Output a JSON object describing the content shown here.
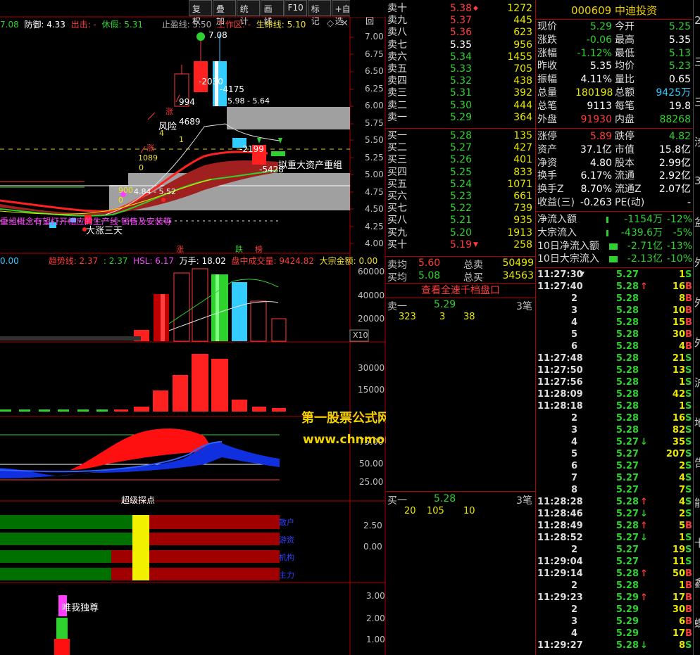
{
  "toolbar": [
    "复权",
    "叠加",
    "统计",
    "画线",
    "F10",
    "标记",
    "+自选",
    "返回"
  ],
  "main_indicator": {
    "a": "7.08",
    "b": "防御: 4.33",
    "c": "出击: -",
    "d": "休假: 5.31",
    "e": "止盈线: 5.50",
    "f": "工作区: -",
    "g": "生命线: 5.10"
  },
  "price_axis": [
    "7.00",
    "6.75",
    "6.50",
    "6.25",
    "6.00",
    "5.75",
    "5.50",
    "5.25",
    "5.00",
    "4.75",
    "4.50",
    "4.25",
    "4.00"
  ],
  "chart_labels": {
    "hi": "7.08",
    "l2030": "-2030",
    "l4175": "-4175",
    "l994": "994",
    "l4689": "4689",
    "fx": "风险",
    "f4": "4",
    "f1": "1",
    "zz": "5.98 - 5.64",
    "l2199": "-2199",
    "l5428": "-5428",
    "news": "拟重大资产重组",
    "zhang1": "涨",
    "zhang2": "涨",
    "z1089": "1089",
    "z0": "0",
    "l484": "4.84 - 5.52",
    "l900": "900",
    "z0b": "0",
    "dzst": "大涨三天",
    "bottom_text": "重组概念有望打开相应的生产线 销售及安装等",
    "t1": "涨",
    "t2": "跌",
    "t3": "榜",
    "x10": "X10",
    "cjzd": "超级探点",
    "wwdz": "唯我独尊"
  },
  "vol_header": {
    "a": "0.00",
    "b": "趋势线: 2.37",
    "c": ": 2.37",
    "d": "HSL: 6.17",
    "e": "万手: 18.02",
    "f": "盘中成交量: 9424.82",
    "g": "大宗金额: 0.00"
  },
  "vol_axis": [
    "60000",
    "40000",
    "20000"
  ],
  "p3_axis": [
    "30000",
    "15000"
  ],
  "p4_axis": [
    "75.00",
    "50.00",
    "25.00"
  ],
  "p5_axis": [
    "2.50",
    "0.00"
  ],
  "p5_labels": [
    "散户",
    "游资",
    "机构",
    "主力"
  ],
  "p6_axis": [
    "3.00",
    "2.00",
    "1.00"
  ],
  "watermark": {
    "line1": "第一股票公式网",
    "line2": "www.chnmoney.com"
  },
  "sells": [
    {
      "name": "卖十",
      "price": "5.38",
      "flag": "◆",
      "vol": "1272",
      "color": "#ff3c3c"
    },
    {
      "name": "卖九",
      "price": "5.37",
      "vol": "445",
      "color": "#ff3c3c"
    },
    {
      "name": "卖八",
      "price": "5.36",
      "vol": "623",
      "color": "#ff3c3c"
    },
    {
      "name": "卖七",
      "price": "5.35",
      "vol": "956",
      "color": "#ffffff"
    },
    {
      "name": "卖六",
      "price": "5.34",
      "vol": "1455",
      "color": "#2fd12f"
    },
    {
      "name": "卖五",
      "price": "5.33",
      "vol": "705",
      "color": "#2fd12f"
    },
    {
      "name": "卖四",
      "price": "5.32",
      "vol": "438",
      "color": "#2fd12f"
    },
    {
      "name": "卖三",
      "price": "5.31",
      "vol": "392",
      "color": "#2fd12f"
    },
    {
      "name": "卖二",
      "price": "5.30",
      "vol": "444",
      "color": "#2fd12f"
    },
    {
      "name": "卖一",
      "price": "5.29",
      "vol": "364",
      "color": "#2fd12f"
    }
  ],
  "buys": [
    {
      "name": "买一",
      "price": "5.28",
      "vol": "135",
      "color": "#2fd12f"
    },
    {
      "name": "买二",
      "price": "5.27",
      "vol": "427",
      "color": "#2fd12f"
    },
    {
      "name": "买三",
      "price": "5.26",
      "vol": "401",
      "color": "#2fd12f"
    },
    {
      "name": "买四",
      "price": "5.25",
      "vol": "833",
      "color": "#2fd12f"
    },
    {
      "name": "买五",
      "price": "5.24",
      "vol": "1071",
      "color": "#2fd12f"
    },
    {
      "name": "买六",
      "price": "5.23",
      "vol": "661",
      "color": "#2fd12f"
    },
    {
      "name": "买七",
      "price": "5.22",
      "vol": "739",
      "color": "#2fd12f"
    },
    {
      "name": "买八",
      "price": "5.21",
      "vol": "935",
      "color": "#2fd12f"
    },
    {
      "name": "买九",
      "price": "5.20",
      "vol": "1913",
      "color": "#2fd12f"
    },
    {
      "name": "买十",
      "price": "5.19",
      "flag": "▼",
      "vol": "258",
      "color": "#ff3c3c"
    }
  ],
  "avg": {
    "sell_label": "卖均",
    "sell_price": "5.60",
    "sell_total_label": "总卖",
    "sell_total": "50499",
    "buy_label": "买均",
    "buy_price": "5.08",
    "buy_total_label": "总买",
    "buy_total": "34563"
  },
  "full_depth_button": "查看全速千档盘口",
  "sell1_detail": {
    "label": "卖一",
    "price": "5.29",
    "count": "3笔",
    "orders": [
      "323",
      "3",
      "38"
    ]
  },
  "buy1_detail": {
    "label": "买一",
    "price": "5.28",
    "count": "3笔",
    "orders": [
      "20",
      "105",
      "10"
    ]
  },
  "stock": {
    "code": "000609",
    "name": "中迪投资"
  },
  "quote_rows": [
    {
      "l1": "现价",
      "v1": "5.29",
      "c1": "#2fd12f",
      "l2": "今开",
      "v2": "5.25",
      "c2": "#2fd12f"
    },
    {
      "l1": "涨跌",
      "v1": "-0.06",
      "c1": "#2fd12f",
      "l2": "最高",
      "v2": "5.35",
      "c2": "#ffffff"
    },
    {
      "l1": "涨幅",
      "v1": "-1.12%",
      "c1": "#2fd12f",
      "l2": "最低",
      "v2": "5.13",
      "c2": "#2fd12f"
    },
    {
      "l1": "昨收",
      "v1": "5.35",
      "c1": "#ffffff",
      "l2": "均价",
      "v2": "5.23",
      "c2": "#2fd12f"
    },
    {
      "l1": "振幅",
      "v1": "4.11%",
      "c1": "#ffffff",
      "l2": "量比",
      "v2": "0.65",
      "c2": "#ffffff"
    },
    {
      "l1": "总量",
      "v1": "180198",
      "c1": "#e8e800",
      "l2": "总额",
      "v2": "9425万",
      "c2": "#3cf"
    },
    {
      "l1": "总笔",
      "v1": "9113",
      "c1": "#ffffff",
      "l2": "每笔",
      "v2": "19.8",
      "c2": "#ffffff"
    },
    {
      "l1": "外盘",
      "v1": "91930",
      "c1": "#ff3c3c",
      "l2": "内盘",
      "v2": "88268",
      "c2": "#2fd12f"
    }
  ],
  "quote_rows2": [
    {
      "l1": "涨停",
      "v1": "5.89",
      "c1": "#ff3c3c",
      "l2": "跌停",
      "v2": "4.82",
      "c2": "#2fd12f"
    },
    {
      "l1": "资产",
      "v1": "37.1亿",
      "c1": "#ffffff",
      "l2": "市值",
      "v2": "15.8亿",
      "c2": "#ffffff"
    },
    {
      "l1": "净资",
      "v1": "4.80",
      "c1": "#ffffff",
      "l2": "股本",
      "v2": "2.99亿",
      "c2": "#ffffff"
    },
    {
      "l1": "换手",
      "v1": "6.17%",
      "c1": "#ffffff",
      "l2": "流通",
      "v2": "2.92亿",
      "c2": "#ffffff"
    },
    {
      "l1": "换手Z",
      "v1": "8.70%",
      "c1": "#ffffff",
      "l2": "流通Z",
      "v2": "2.07亿",
      "c2": "#ffffff"
    },
    {
      "l1": "收益(三)",
      "v1": "-0.263",
      "c1": "#ffffff",
      "l2": "PE(动)",
      "v2": "-",
      "c2": "#ffffff"
    }
  ],
  "flows": [
    {
      "label": "净流入额",
      "value": "-1154万",
      "pct": "-12%"
    },
    {
      "label": "大宗流入",
      "value": "-439.6万",
      "pct": "-5%"
    },
    {
      "label": "10日净流入额",
      "value": "-2.71亿",
      "pct": "-13%"
    },
    {
      "label": "10日大宗流入",
      "value": "-2.13亿",
      "pct": "-10%"
    }
  ],
  "ticks": [
    {
      "t": "11:27:30",
      "mark": "▼",
      "p": "5.27",
      "pc": "#2fd12f",
      "a": "",
      "v": "1",
      "s": "S"
    },
    {
      "t": "11:27:40",
      "p": "5.28",
      "pc": "#2fd12f",
      "a": "↑",
      "ac": "#ff3c3c",
      "v": "16",
      "s": "B"
    },
    {
      "t": "2",
      "p": "5.28",
      "pc": "#2fd12f",
      "a": "",
      "v": "8",
      "s": "B"
    },
    {
      "t": "3",
      "p": "5.28",
      "pc": "#2fd12f",
      "a": "",
      "v": "10",
      "s": "B"
    },
    {
      "t": "4",
      "p": "5.28",
      "pc": "#2fd12f",
      "a": "",
      "v": "15",
      "s": "B"
    },
    {
      "t": "5",
      "p": "5.28",
      "pc": "#2fd12f",
      "a": "",
      "v": "30",
      "s": "B"
    },
    {
      "t": "6",
      "p": "5.28",
      "pc": "#2fd12f",
      "a": "",
      "v": "4",
      "s": "B"
    },
    {
      "t": "11:27:48",
      "p": "5.28",
      "pc": "#2fd12f",
      "a": "",
      "v": "21",
      "s": "S"
    },
    {
      "t": "11:27:50",
      "p": "5.28",
      "pc": "#2fd12f",
      "a": "",
      "v": "13",
      "s": "S"
    },
    {
      "t": "11:27:56",
      "p": "5.28",
      "pc": "#2fd12f",
      "a": "",
      "v": "1",
      "s": "S"
    },
    {
      "t": "11:28:09",
      "p": "5.28",
      "pc": "#2fd12f",
      "a": "",
      "v": "42",
      "s": "S"
    },
    {
      "t": "11:28:18",
      "p": "5.28",
      "pc": "#2fd12f",
      "a": "",
      "v": "1",
      "s": "S"
    },
    {
      "t": "2",
      "p": "5.28",
      "pc": "#2fd12f",
      "a": "",
      "v": "16",
      "s": "S"
    },
    {
      "t": "3",
      "p": "5.28",
      "pc": "#2fd12f",
      "a": "",
      "v": "82",
      "s": "S"
    },
    {
      "t": "4",
      "p": "5.27",
      "pc": "#2fd12f",
      "a": "↓",
      "ac": "#2fd12f",
      "v": "35",
      "s": "S"
    },
    {
      "t": "5",
      "p": "5.27",
      "pc": "#2fd12f",
      "a": "",
      "v": "207",
      "s": "S"
    },
    {
      "t": "6",
      "p": "5.27",
      "pc": "#2fd12f",
      "a": "",
      "v": "2",
      "s": "S"
    },
    {
      "t": "7",
      "p": "5.27",
      "pc": "#2fd12f",
      "a": "",
      "v": "4",
      "s": "S"
    },
    {
      "t": "8",
      "p": "5.27",
      "pc": "#2fd12f",
      "a": "",
      "v": "7",
      "s": "S"
    },
    {
      "t": "11:28:28",
      "p": "5.28",
      "pc": "#2fd12f",
      "a": "↑",
      "ac": "#ff3c3c",
      "v": "4",
      "s": "S"
    },
    {
      "t": "11:28:46",
      "p": "5.27",
      "pc": "#2fd12f",
      "a": "↓",
      "ac": "#2fd12f",
      "v": "2",
      "s": "S"
    },
    {
      "t": "11:28:49",
      "p": "5.28",
      "pc": "#2fd12f",
      "a": "↑",
      "ac": "#ff3c3c",
      "v": "5",
      "s": "B"
    },
    {
      "t": "11:28:52",
      "p": "5.27",
      "pc": "#2fd12f",
      "a": "↓",
      "ac": "#2fd12f",
      "v": "1",
      "s": "S"
    },
    {
      "t": "2",
      "p": "5.27",
      "pc": "#2fd12f",
      "a": "",
      "v": "19",
      "s": "S"
    },
    {
      "t": "11:29:04",
      "p": "5.27",
      "pc": "#2fd12f",
      "a": "",
      "v": "11",
      "s": "S"
    },
    {
      "t": "11:29:14",
      "p": "5.28",
      "pc": "#2fd12f",
      "a": "↑",
      "ac": "#ff3c3c",
      "v": "50",
      "s": "B"
    },
    {
      "t": "2",
      "p": "5.28",
      "pc": "#2fd12f",
      "a": "",
      "v": "1",
      "s": "B"
    },
    {
      "t": "11:29:23",
      "p": "5.29",
      "pc": "#2fd12f",
      "a": "↑",
      "ac": "#ff3c3c",
      "v": "17",
      "s": "B"
    },
    {
      "t": "2",
      "p": "5.29",
      "pc": "#2fd12f",
      "a": "",
      "v": "30",
      "s": "B"
    },
    {
      "t": "3",
      "p": "5.29",
      "pc": "#2fd12f",
      "a": "",
      "v": "6",
      "s": "B"
    },
    {
      "t": "4",
      "p": "5.29",
      "pc": "#2fd12f",
      "a": "",
      "v": "17",
      "s": "B"
    },
    {
      "t": "11:29:27",
      "p": "5.28",
      "pc": "#2fd12f",
      "a": "↓",
      "ac": "#2fd12f",
      "v": "8",
      "s": "S"
    }
  ],
  "edge_chars": [
    "2",
    "三",
    "三",
    "涉",
    "3",
    "盆",
    "外",
    "外",
    "外",
    "沪",
    "地",
    "告",
    "能",
    "卡",
    "鑫",
    "蝶"
  ]
}
